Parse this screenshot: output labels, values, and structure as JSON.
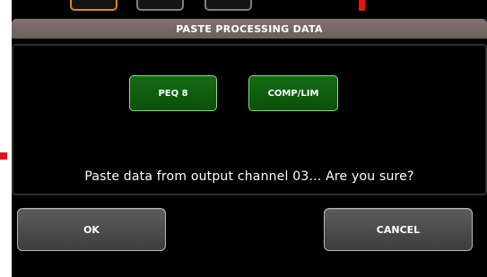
{
  "dialog": {
    "title": "PASTE PROCESSING DATA",
    "chips": [
      {
        "label": "PEQ 8"
      },
      {
        "label": "COMP/LIM"
      }
    ],
    "message": "Paste data from output channel 03... Are you sure?"
  },
  "buttons": {
    "ok_label": "OK",
    "cancel_label": "CANCEL"
  },
  "colors": {
    "title_bar": "#7a6e6a",
    "chip_green": "#0e5c0e",
    "tab_active_orange": "#d88a1e",
    "marker_red": "#e2141c"
  }
}
